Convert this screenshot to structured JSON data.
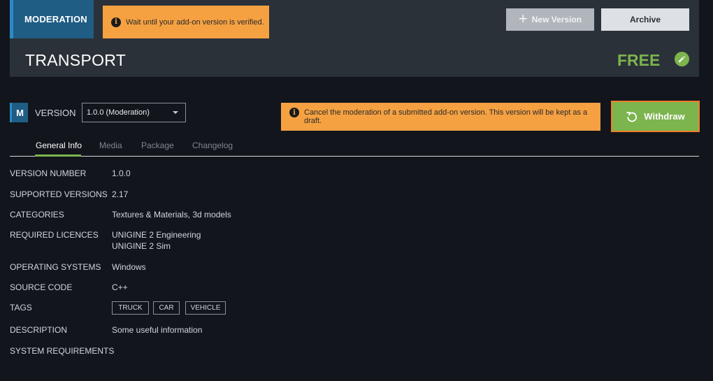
{
  "header": {
    "status_badge": "MODERATION",
    "wait_notice": "Wait until your add-on version is verified.",
    "new_version_label": "New Version",
    "archive_label": "Archive",
    "addon_title": "TRANSPORT",
    "price": "FREE"
  },
  "version_row": {
    "badge_letter": "M",
    "label": "VERSION",
    "selected_version": "1.0.0 (Moderation)",
    "cancel_notice": "Cancel the moderation of a submitted add-on version. This version will be kept as a draft.",
    "withdraw_label": "Withdraw"
  },
  "tabs": [
    {
      "label": "General Info",
      "active": true
    },
    {
      "label": "Media",
      "active": false
    },
    {
      "label": "Package",
      "active": false
    },
    {
      "label": "Changelog",
      "active": false
    }
  ],
  "details": {
    "version_number": {
      "label": "VERSION NUMBER",
      "value": "1.0.0"
    },
    "supported_versions": {
      "label": "SUPPORTED VERSIONS",
      "value": "2.17"
    },
    "categories": {
      "label": "CATEGORIES",
      "value": "Textures & Materials, 3d models"
    },
    "required_licences": {
      "label": "REQUIRED LICENCES",
      "values": [
        "UNIGINE 2 Engineering",
        "UNIGINE 2 Sim"
      ]
    },
    "operating_systems": {
      "label": "OPERATING SYSTEMS",
      "value": "Windows"
    },
    "source_code": {
      "label": "SOURCE CODE",
      "value": "C++"
    },
    "tags": {
      "label": "TAGS",
      "values": [
        "TRUCK",
        "CAR",
        "VEHICLE"
      ]
    },
    "description": {
      "label": "DESCRIPTION",
      "value": "Some useful information"
    },
    "system_requirements": {
      "label": "SYSTEM REQUIREMENTS",
      "value": ""
    }
  },
  "colors": {
    "accent_green": "#7cb44e",
    "notice_orange": "#f5a142",
    "badge_blue": "#1f5d84",
    "background": "#12151c"
  },
  "icons": {
    "info": "info-icon",
    "plus": "plus-icon",
    "edit": "pencil-icon",
    "withdraw": "undo-icon",
    "dropdown": "chevron-down-icon"
  }
}
